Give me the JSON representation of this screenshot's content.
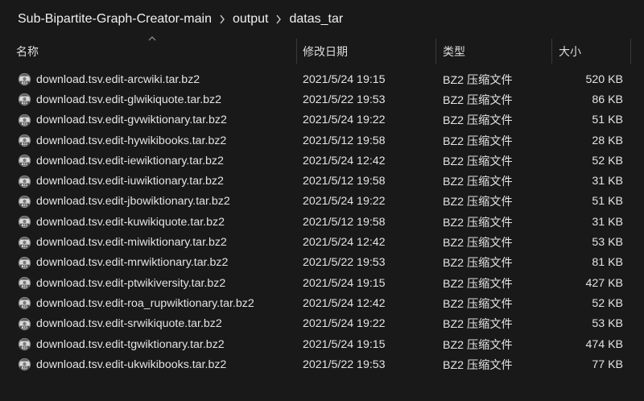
{
  "breadcrumb": {
    "items": [
      "Sub-Bipartite-Graph-Creator-main",
      "output",
      "datas_tar"
    ]
  },
  "columns": {
    "name": "名称",
    "date": "修改日期",
    "type": "类型",
    "size": "大小"
  },
  "icons": {
    "file": "bz2-archive-icon",
    "separator": "chevron-right-icon",
    "sort": "sort-ascending-icon"
  },
  "files": [
    {
      "name": "download.tsv.edit-arcwiki.tar.bz2",
      "date": "2021/5/24 19:15",
      "type": "BZ2 压缩文件",
      "size": "520 KB"
    },
    {
      "name": "download.tsv.edit-glwikiquote.tar.bz2",
      "date": "2021/5/22 19:53",
      "type": "BZ2 压缩文件",
      "size": "86 KB"
    },
    {
      "name": "download.tsv.edit-gvwiktionary.tar.bz2",
      "date": "2021/5/24 19:22",
      "type": "BZ2 压缩文件",
      "size": "51 KB"
    },
    {
      "name": "download.tsv.edit-hywikibooks.tar.bz2",
      "date": "2021/5/12 19:58",
      "type": "BZ2 压缩文件",
      "size": "28 KB"
    },
    {
      "name": "download.tsv.edit-iewiktionary.tar.bz2",
      "date": "2021/5/24 12:42",
      "type": "BZ2 压缩文件",
      "size": "52 KB"
    },
    {
      "name": "download.tsv.edit-iuwiktionary.tar.bz2",
      "date": "2021/5/12 19:58",
      "type": "BZ2 压缩文件",
      "size": "31 KB"
    },
    {
      "name": "download.tsv.edit-jbowiktionary.tar.bz2",
      "date": "2021/5/24 19:22",
      "type": "BZ2 压缩文件",
      "size": "51 KB"
    },
    {
      "name": "download.tsv.edit-kuwikiquote.tar.bz2",
      "date": "2021/5/12 19:58",
      "type": "BZ2 压缩文件",
      "size": "31 KB"
    },
    {
      "name": "download.tsv.edit-miwiktionary.tar.bz2",
      "date": "2021/5/24 12:42",
      "type": "BZ2 压缩文件",
      "size": "53 KB"
    },
    {
      "name": "download.tsv.edit-mrwiktionary.tar.bz2",
      "date": "2021/5/22 19:53",
      "type": "BZ2 压缩文件",
      "size": "81 KB"
    },
    {
      "name": "download.tsv.edit-ptwikiversity.tar.bz2",
      "date": "2021/5/24 19:15",
      "type": "BZ2 压缩文件",
      "size": "427 KB"
    },
    {
      "name": "download.tsv.edit-roa_rupwiktionary.tar.bz2",
      "date": "2021/5/24 12:42",
      "type": "BZ2 压缩文件",
      "size": "52 KB"
    },
    {
      "name": "download.tsv.edit-srwikiquote.tar.bz2",
      "date": "2021/5/24 19:22",
      "type": "BZ2 压缩文件",
      "size": "53 KB"
    },
    {
      "name": "download.tsv.edit-tgwiktionary.tar.bz2",
      "date": "2021/5/24 19:15",
      "type": "BZ2 压缩文件",
      "size": "474 KB"
    },
    {
      "name": "download.tsv.edit-ukwikibooks.tar.bz2",
      "date": "2021/5/22 19:53",
      "type": "BZ2 压缩文件",
      "size": "77 KB"
    }
  ]
}
